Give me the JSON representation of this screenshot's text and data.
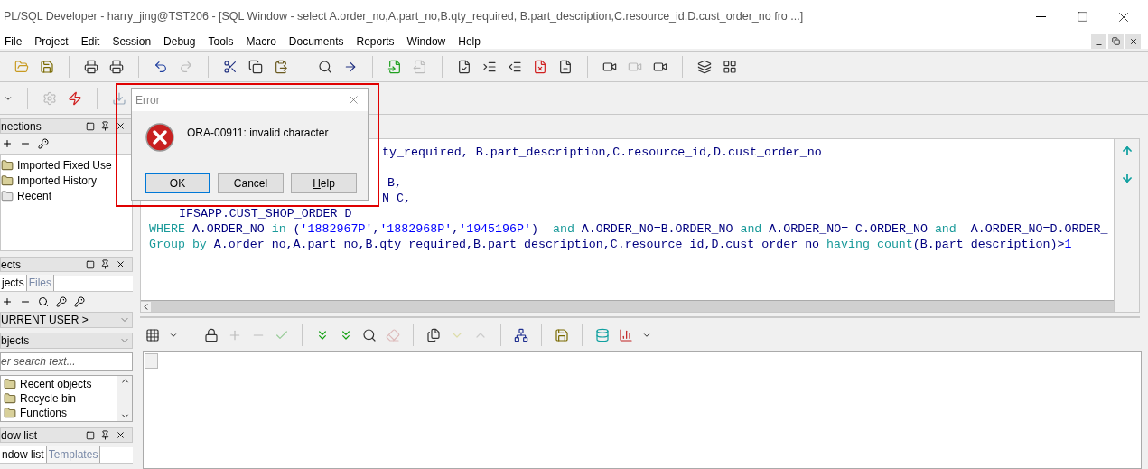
{
  "window": {
    "title": "PL/SQL Developer - harry_jing@TST206 - [SQL Window - select A.order_no,A.part_no,B.qty_required, B.part_description,C.resource_id,D.cust_order_no fro ...]"
  },
  "menu": [
    "File",
    "Project",
    "Edit",
    "Session",
    "Debug",
    "Tools",
    "Macro",
    "Documents",
    "Reports",
    "Window",
    "Help"
  ],
  "connections": {
    "title": "nections",
    "items": [
      {
        "label": "Imported Fixed Use",
        "kind": "folder"
      },
      {
        "label": "Imported History",
        "kind": "folder"
      },
      {
        "label": "Recent",
        "kind": "recent"
      }
    ]
  },
  "objects": {
    "title": "ects",
    "tabs": [
      {
        "label": "jects",
        "selected": true
      },
      {
        "label": "Files",
        "selected": false
      }
    ],
    "user_select": "URRENT USER >",
    "type_select": "bjects",
    "search": {
      "placeholder": "er search text..."
    },
    "items": [
      "Recent objects",
      "Recycle bin",
      "Functions"
    ]
  },
  "window_list": {
    "title": "dow list",
    "tabs": [
      {
        "label": "ndow list",
        "selected": true
      },
      {
        "label": "Templates",
        "selected": false
      }
    ]
  },
  "editor": {
    "lines": [
      [
        {
          "text": "ty_required, B.part_description,C.resource_id,D.cust_order_no",
          "kind": "ident"
        }
      ],
      [
        {
          "text": "B,",
          "kind": "ident"
        }
      ],
      [
        {
          "text": "N C,",
          "kind": "ident"
        }
      ],
      [
        {
          "text": "IFSAPP.CUST_SHOP_ORDER D",
          "kind": "ident"
        }
      ],
      [
        {
          "text": "WHERE",
          "kind": "keyword"
        },
        {
          "text": " A.ORDER_NO ",
          "kind": "ident"
        },
        {
          "text": "in",
          "kind": "keyword"
        },
        {
          "text": " (",
          "kind": "ident"
        },
        {
          "text": "'1882967P'",
          "kind": "string"
        },
        {
          "text": ",",
          "kind": "ident"
        },
        {
          "text": "'1882968P'",
          "kind": "string"
        },
        {
          "text": ",",
          "kind": "ident"
        },
        {
          "text": "'1945196P'",
          "kind": "string"
        },
        {
          "text": ")  ",
          "kind": "ident"
        },
        {
          "text": "and",
          "kind": "keyword"
        },
        {
          "text": " A.ORDER_NO=B.ORDER_NO ",
          "kind": "ident"
        },
        {
          "text": "and",
          "kind": "keyword"
        },
        {
          "text": " A.ORDER_NO= C.ORDER_NO ",
          "kind": "ident"
        },
        {
          "text": "and",
          "kind": "keyword"
        },
        {
          "text": "  A.ORDER_NO=D.ORDER_",
          "kind": "ident"
        }
      ],
      [
        {
          "text": "Group by",
          "kind": "keyword"
        },
        {
          "text": " A.order_no,A.part_no,B.qty_required,B.part_description,C.resource_id,D.cust_order_no ",
          "kind": "ident"
        },
        {
          "text": "having count",
          "kind": "keyword"
        },
        {
          "text": "(B.part_description)>",
          "kind": "ident"
        },
        {
          "text": "1",
          "kind": "string"
        }
      ]
    ]
  },
  "dialog": {
    "title": "Error",
    "message": "ORA-00911: invalid character",
    "buttons": [
      {
        "label": "OK",
        "default": true
      },
      {
        "label": "Cancel",
        "default": false
      },
      {
        "label": "Help",
        "default": false
      }
    ]
  }
}
